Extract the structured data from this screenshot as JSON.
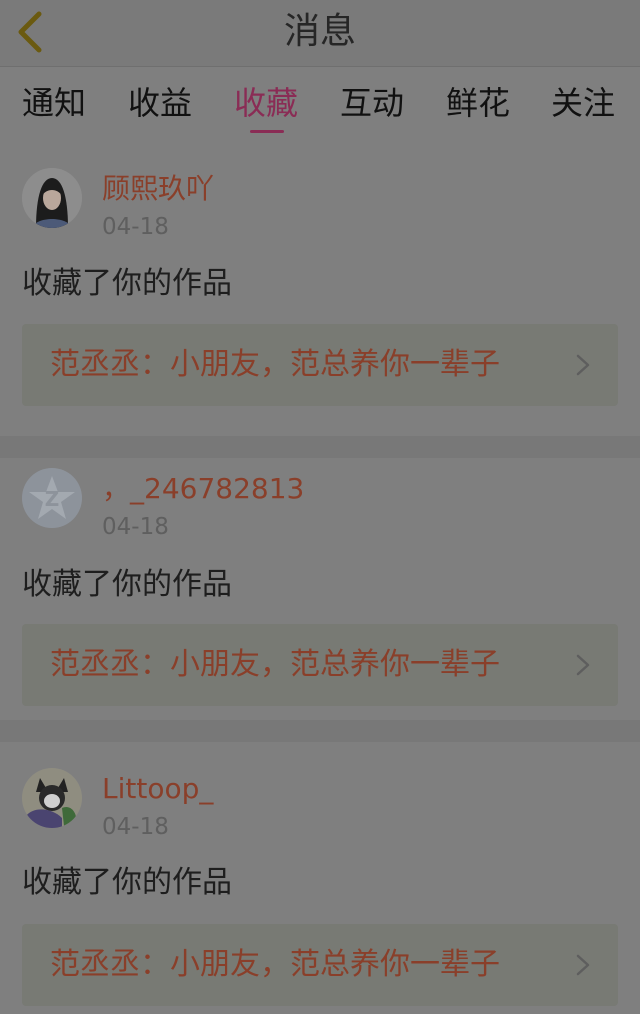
{
  "header": {
    "title": "消息",
    "back_icon": "chevron-left-icon"
  },
  "tabs": [
    {
      "label": "通知",
      "active": false
    },
    {
      "label": "收益",
      "active": false
    },
    {
      "label": "收藏",
      "active": true
    },
    {
      "label": "互动",
      "active": false
    },
    {
      "label": "鲜花",
      "active": false
    },
    {
      "label": "关注",
      "active": false
    }
  ],
  "notifications": [
    {
      "user": "顾熙玖吖",
      "date": "04-18",
      "action": "收藏了你的作品",
      "work": "范丞丞：小朋友，范总养你一辈子",
      "avatar": "photo-avatar"
    },
    {
      "user": "，_246782813",
      "date": "04-18",
      "action": "收藏了你的作品",
      "work": "范丞丞：小朋友，范总养你一辈子",
      "avatar": "default-star-avatar"
    },
    {
      "user": "Littoop_",
      "date": "04-18",
      "action": "收藏了你的作品",
      "work": "范丞丞：小朋友，范总养你一辈子",
      "avatar": "cartoon-avatar"
    }
  ],
  "colors": {
    "accent": "#8a2c55",
    "name": "#8a3f2a",
    "background": "#7f7f7f"
  }
}
